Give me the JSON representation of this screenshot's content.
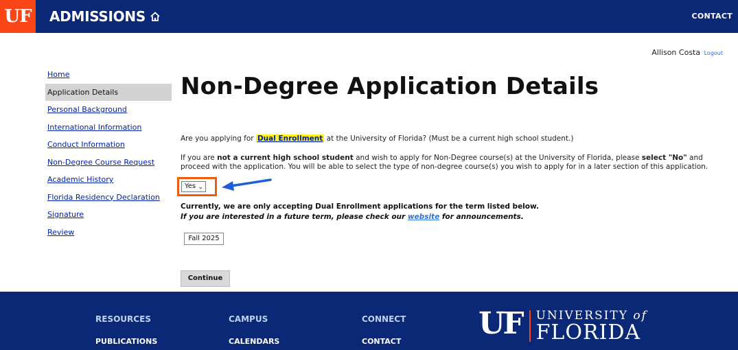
{
  "header": {
    "logo": "UF",
    "site_title": "ADMISSIONS",
    "contact": "CONTACT"
  },
  "user": {
    "name": "Allison Costa",
    "logout": "Logout"
  },
  "sidebar": {
    "items": [
      {
        "label": "Home"
      },
      {
        "label": "Application Details"
      },
      {
        "label": "Personal Background"
      },
      {
        "label": "International Information"
      },
      {
        "label": "Conduct Information"
      },
      {
        "label": "Non-Degree Course Request"
      },
      {
        "label": "Academic History"
      },
      {
        "label": "Florida Residency Declaration"
      },
      {
        "label": "Signature"
      },
      {
        "label": "Review"
      }
    ],
    "active_index": 1
  },
  "main": {
    "title": "Non-Degree Application Details",
    "question_pre": "Are you applying for ",
    "question_link": "Dual Enrollment",
    "question_post": " at the University of Florida? (Must be a current high school student.)",
    "info_1": "If you are ",
    "info_bold_1": "not a current high school student",
    "info_2": " and wish to apply for Non-Degree course(s) at the University of Florida, please ",
    "info_bold_2": "select \"No\"",
    "info_3": " and proceed with the application. You will be able to select the type of non-degree course(s) you wish to apply for in a later section of this application.",
    "select_value": "Yes",
    "notice_line1": "Currently, we are only accepting Dual Enrollment applications for the term listed below.",
    "notice_line2_pre": "If you are interested in a future term, please check our ",
    "notice_line2_link": "website",
    "notice_line2_post": " for announcements.",
    "term": "Fall 2025",
    "continue_label": "Continue"
  },
  "footer": {
    "columns": [
      {
        "heading": "RESOURCES",
        "link": "PUBLICATIONS"
      },
      {
        "heading": "CAMPUS",
        "link": "CALENDARS"
      },
      {
        "heading": "CONNECT",
        "link": "CONTACT"
      }
    ],
    "logo_letters": "UF",
    "logo_university": "UNIVERSITY",
    "logo_of": "of",
    "logo_florida": "FLORIDA"
  },
  "colors": {
    "header_blue": "#0b2877",
    "uf_orange": "#fa4616",
    "highlight_yellow": "#ffef1a",
    "annotation_arrow": "#1f5ed8",
    "annotation_box": "#f25a0c"
  }
}
